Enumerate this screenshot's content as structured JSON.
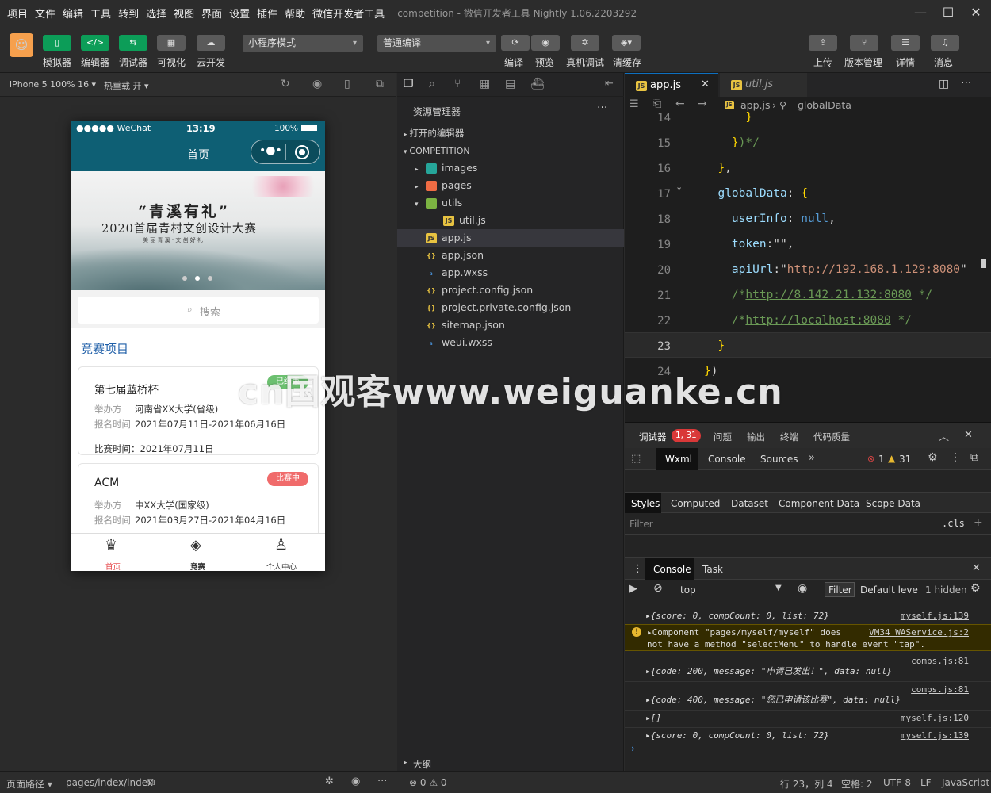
{
  "menubar": {
    "items": [
      "项目",
      "文件",
      "编辑",
      "工具",
      "转到",
      "选择",
      "视图",
      "界面",
      "设置",
      "插件",
      "帮助",
      "微信开发者工具"
    ],
    "window_title": "competition - 微信开发者工具 Nightly 1.06.2203292"
  },
  "toolbar": {
    "left_buttons": [
      {
        "icon": "phone-icon",
        "label": "模拟器"
      },
      {
        "icon": "code-icon",
        "label": "编辑器"
      },
      {
        "icon": "debug-icon",
        "label": "调试器"
      },
      {
        "icon": "visual-icon",
        "label": "可视化"
      },
      {
        "icon": "cloud-icon",
        "label": "云开发"
      }
    ],
    "mode_select": "小程序模式",
    "compile_select": "普通编译",
    "mid_buttons": [
      {
        "icon": "refresh-icon",
        "label": "编译"
      },
      {
        "icon": "eye-icon",
        "label": "预览"
      },
      {
        "icon": "bug-icon",
        "label": "真机调试"
      },
      {
        "icon": "layers-icon",
        "label": "清缓存"
      }
    ],
    "right_buttons": [
      {
        "icon": "upload-icon",
        "label": "上传"
      },
      {
        "icon": "branch-icon",
        "label": "版本管理"
      },
      {
        "icon": "menu-icon",
        "label": "详情"
      },
      {
        "icon": "bell-icon",
        "label": "消息"
      }
    ]
  },
  "simulator": {
    "device": "iPhone 5 100% 16 ▾",
    "hot_reload": "热重载 开 ▾",
    "status": {
      "carrier": "●●●●● WeChat",
      "time": "13:19",
      "battery": "100%"
    },
    "nav_title": "首页",
    "banner": {
      "headline": "“青溪有礼”",
      "title": "2020首届青村文创设计大赛",
      "subtitle": "美 丽 青 溪 · 文 创 好 礼"
    },
    "search_placeholder": "搜索",
    "section_title": "竞赛项目",
    "cards": [
      {
        "name": "第七届蓝桥杯",
        "badge": "已结束",
        "org_label": "举办方",
        "org": "河南省XX大学(省级)",
        "signup_label": "报名时间",
        "signup": "2021年07月11日-2021年06月16日",
        "match": "比赛时间：2021年07月11日"
      },
      {
        "name": "ACM",
        "badge": "比赛中",
        "org_label": "举办方",
        "org": "中XX大学(国家级)",
        "signup_label": "报名时间",
        "signup": "2021年03月27日-2021年04月16日"
      }
    ],
    "tabbar": [
      {
        "icon": "trophy-icon",
        "label": "首页",
        "active": true
      },
      {
        "icon": "layers-icon",
        "label": "竞赛",
        "active": false
      },
      {
        "icon": "person-icon",
        "label": "个人中心",
        "active": false
      }
    ]
  },
  "explorer": {
    "title": "资源管理器",
    "open_editors": "打开的编辑器",
    "project": "COMPETITION",
    "files": [
      {
        "name": "images",
        "type": "folder",
        "icon_color": "#26a69a",
        "depth": 1,
        "arrow": "▸"
      },
      {
        "name": "pages",
        "type": "folder",
        "icon_color": "#ef6c44",
        "depth": 1,
        "arrow": "▸"
      },
      {
        "name": "utils",
        "type": "folder",
        "icon_color": "#7cb342",
        "depth": 1,
        "arrow": "▾"
      },
      {
        "name": "util.js",
        "type": "js",
        "depth": 2,
        "arrow": ""
      },
      {
        "name": "app.js",
        "type": "js",
        "depth": 1,
        "arrow": "",
        "selected": true
      },
      {
        "name": "app.json",
        "type": "json",
        "depth": 1,
        "arrow": ""
      },
      {
        "name": "app.wxss",
        "type": "css",
        "depth": 1,
        "arrow": ""
      },
      {
        "name": "project.config.json",
        "type": "json",
        "depth": 1,
        "arrow": ""
      },
      {
        "name": "project.private.config.json",
        "type": "json",
        "depth": 1,
        "arrow": ""
      },
      {
        "name": "sitemap.json",
        "type": "json",
        "depth": 1,
        "arrow": ""
      },
      {
        "name": "weui.wxss",
        "type": "css",
        "depth": 1,
        "arrow": ""
      }
    ],
    "outline": "大纲"
  },
  "editor": {
    "tabs": [
      {
        "name": "app.js",
        "active": true
      },
      {
        "name": "util.js",
        "active": false
      }
    ],
    "breadcrumb_file": "app.js",
    "breadcrumb_symbol": "globalData",
    "lines": [
      {
        "n": "14",
        "text": "      }"
      },
      {
        "n": "15",
        "text": "    })*/"
      },
      {
        "n": "16",
        "text": "  },"
      },
      {
        "n": "17",
        "text": "  globalData: {"
      },
      {
        "n": "18",
        "text": "    userInfo: null,"
      },
      {
        "n": "19",
        "text": "    token:\"\","
      },
      {
        "n": "20",
        "text": "    apiUrl:\"http://192.168.1.129:8080\""
      },
      {
        "n": "21",
        "text": "    /*http://8.142.21.132:8080 */"
      },
      {
        "n": "22",
        "text": "    /*http://localhost:8080 */"
      },
      {
        "n": "23",
        "text": "  }"
      },
      {
        "n": "24",
        "text": "})"
      }
    ]
  },
  "devtools": {
    "tabs": [
      "调试器",
      "问题",
      "输出",
      "终端",
      "代码质量"
    ],
    "badge": "1, 31",
    "panel_tabs": [
      "Wxml",
      "Console",
      "Sources"
    ],
    "errors": "1",
    "warnings": "31",
    "style_tabs": [
      "Styles",
      "Computed",
      "Dataset",
      "Component Data",
      "Scope Data"
    ],
    "filter_placeholder": "Filter",
    "cls": ".cls",
    "console_tabs": [
      "Console",
      "Task"
    ],
    "context": "top",
    "filter_btn": "Filter",
    "levels": "Default levels",
    "hidden": "1 hidden",
    "logs": [
      {
        "text": "▸{score: 0, compCount: 0, list: 72}",
        "src": "myself.js:139"
      },
      {
        "text": "▸Component \"pages/myself/myself\" does",
        "text2": "not have a method \"selectMenu\" to handle event \"tap\".",
        "src": "VM34 WAService.js:2",
        "warn": true
      },
      {
        "text": "▸{code: 200, message: \"申请已发出！\", data: null}",
        "src": "comps.js:81"
      },
      {
        "text": "▸{code: 400, message: \"您已申请该比赛\", data: null}",
        "src": "comps.js:81"
      },
      {
        "text": "▸[]",
        "src": "myself.js:120"
      },
      {
        "text": "▸{score: 0, compCount: 0, list: 72}",
        "src": "myself.js:139"
      }
    ]
  },
  "statusbar": {
    "path_label": "页面路径 ▾",
    "path": "pages/index/index",
    "problems": "⊗ 0 ⚠ 0",
    "position": "行 23，列 4",
    "spaces": "空格: 2",
    "encoding": "UTF-8",
    "eol": "LF",
    "language": "JavaScript"
  },
  "watermark": "cn国观客www.weiguanke.cn"
}
